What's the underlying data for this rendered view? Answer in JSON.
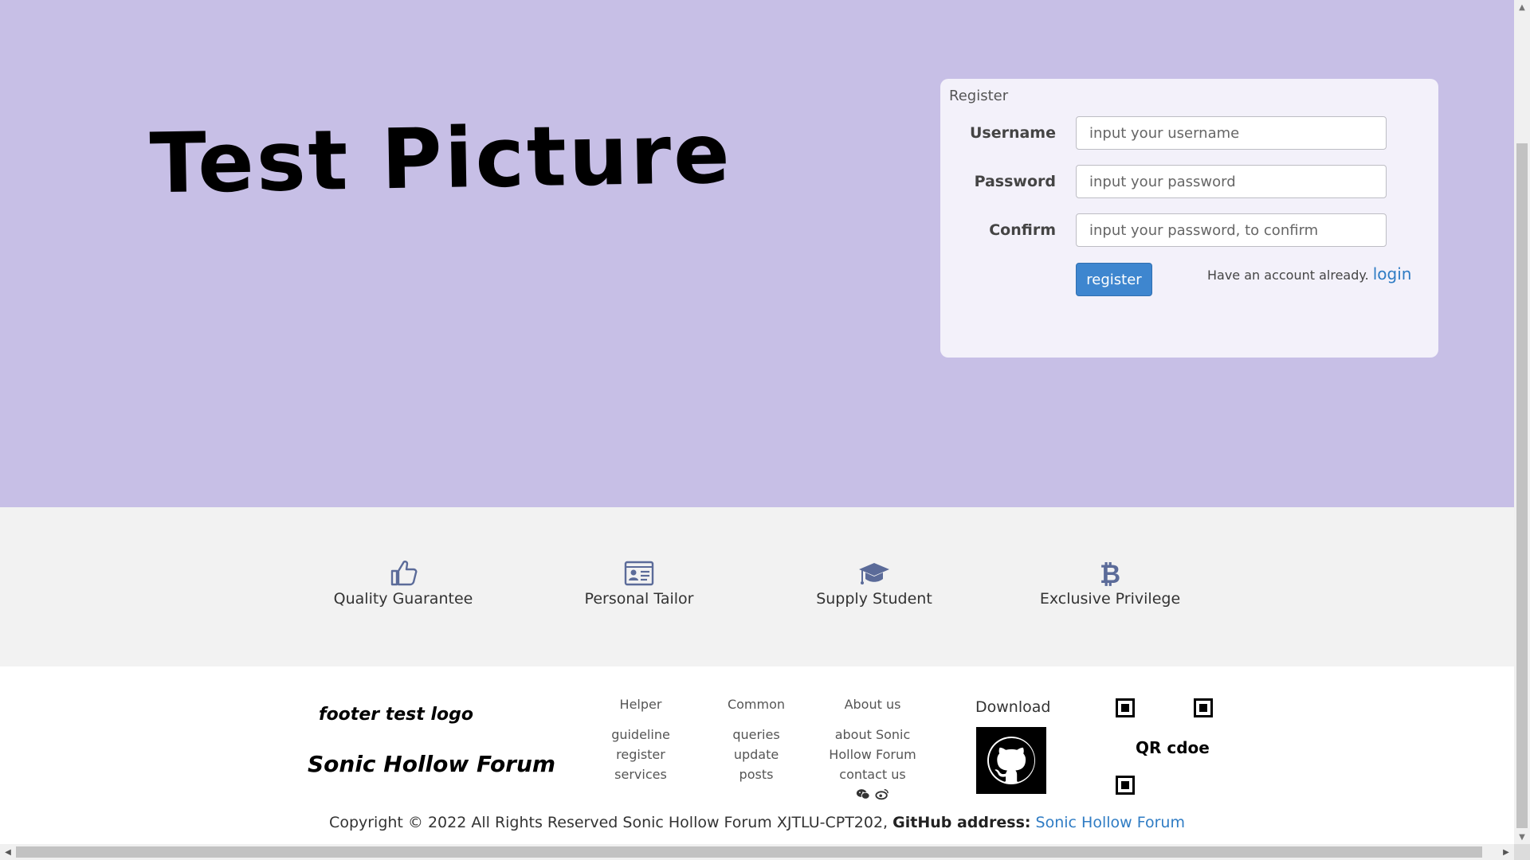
{
  "hero": {
    "title": "Test Picture",
    "background_color": "#c7bfe6"
  },
  "register_form": {
    "heading": "Register",
    "username_label": "Username",
    "username_placeholder": "input your username",
    "password_label": "Password",
    "password_placeholder": "input your password",
    "confirm_label": "Confirm",
    "confirm_placeholder": "input your password, to confirm",
    "submit_label": "register",
    "have_account_text": "Have an account already.",
    "login_link": "login",
    "accent_color": "#3e86cf"
  },
  "features": [
    {
      "label": "Quality Guarantee",
      "icon": "thumbs-up-icon"
    },
    {
      "label": "Personal Tailor",
      "icon": "id-card-icon"
    },
    {
      "label": "Supply Student",
      "icon": "graduation-cap-icon"
    },
    {
      "label": "Exclusive Privilege",
      "icon": "bitcoin-icon"
    }
  ],
  "footer": {
    "logo_text": "footer test logo",
    "forum_name": "Sonic Hollow Forum",
    "columns": [
      {
        "heading": "Helper",
        "links": [
          "guideline",
          "register",
          "services"
        ]
      },
      {
        "heading": "Common",
        "links": [
          "queries",
          "update",
          "posts"
        ]
      },
      {
        "heading": "About us",
        "links": [
          "about Sonic",
          "Hollow Forum",
          "contact us"
        ]
      }
    ],
    "social_icons": [
      "wechat-icon",
      "weibo-icon"
    ],
    "download_label": "Download",
    "download_icon": "github-icon",
    "qr_text": "QR cdoe",
    "copyright_prefix": "Copyright © 2022 All Rights Reserved Sonic Hollow Forum XJTLU-CPT202,",
    "github_label": "GitHub address:",
    "github_link_text": "Sonic Hollow Forum"
  }
}
